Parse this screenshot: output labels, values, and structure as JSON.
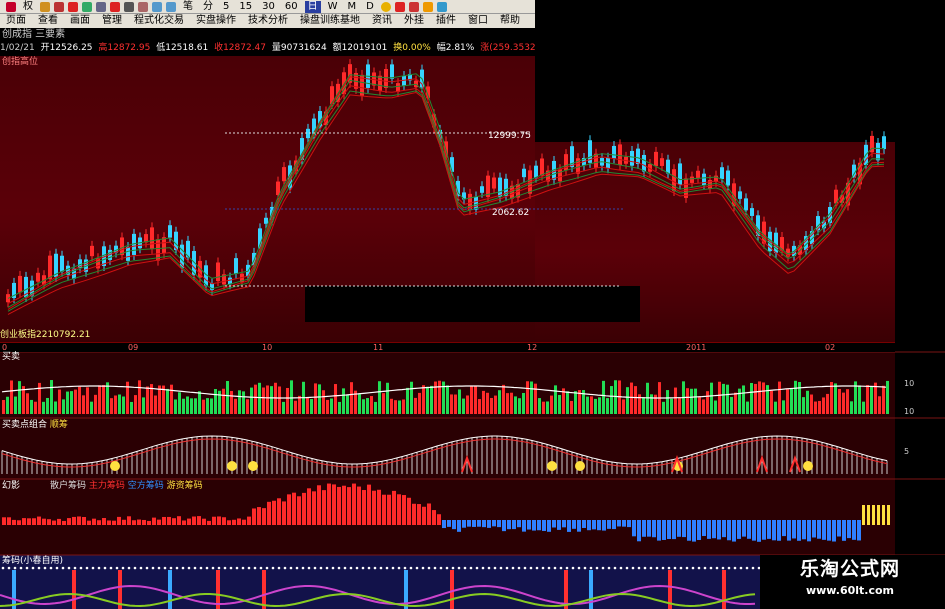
{
  "toolbar": {
    "items": [
      "权",
      "笔",
      "分",
      "5",
      "15",
      "30",
      "60",
      "日",
      "W",
      "M",
      "D"
    ]
  },
  "menubar": {
    "items": [
      "页面",
      "查看",
      "画面",
      "管理",
      "程式化交易",
      "实盘操作",
      "技术分析",
      "操盘训练基地",
      "资讯",
      "外挂",
      "插件",
      "窗口",
      "帮助"
    ]
  },
  "title": {
    "text": "创成指 三要素"
  },
  "quote": {
    "date": "1/02/21",
    "open": "开12526.25",
    "high": "高12872.95",
    "low": "低12518.61",
    "close": "收12872.47",
    "volume": "量90731624",
    "amount": "额12019101",
    "turnover": "换0.00%",
    "change": "幅2.81%",
    "extra": "涨(259.3532.06%"
  },
  "main_chart": {
    "label": "创指高位",
    "high_mark": "12999.75",
    "low_mark": "2062.62",
    "x_ticks": [
      "0",
      "09",
      "10",
      "11",
      "12",
      "2011",
      "02"
    ],
    "footer": "创业板指2210792.21"
  },
  "panels": {
    "vol_label": "买卖",
    "bs_label": "买卖点组合",
    "bs_sub": "顺筹",
    "chip_label": "幻影",
    "chip_legend": [
      "散户筹码",
      "主力筹码",
      "空方筹码",
      "游资筹码"
    ],
    "bottom_label": "筹码(小春自用)",
    "right_ticks_vol": [
      "10",
      "10"
    ],
    "right_ticks_bs": [
      "5"
    ]
  },
  "colors": {
    "up": "#ff2a2a",
    "down": "#36d3ff",
    "green": "#22dd55",
    "yellow": "#ffe040",
    "blue": "#3080ff"
  },
  "watermark": {
    "line1": "乐淘公式网",
    "line2": "www.60lt.com"
  }
}
